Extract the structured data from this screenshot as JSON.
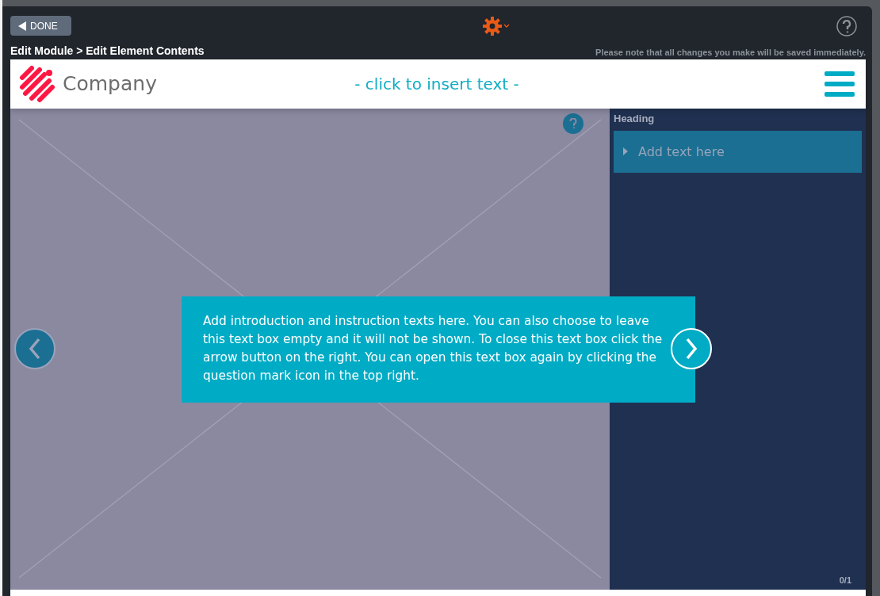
{
  "toolbar": {
    "done_button": "DONE",
    "breadcrumb": "Edit Module > Edit Element Contents",
    "note": "Please note that all changes you make will be saved immediately."
  },
  "header": {
    "logo_text": "Company",
    "title": "- click to insert text -"
  },
  "slide": {
    "intro": "Add introduction and instruction texts here. You can also choose to leave this text box empty and it will not be shown. To close this text box click the arrow button on the right. You can open this text box again by clicking the question mark icon in the top right."
  },
  "sidebar": {
    "heading": "Heading",
    "items": [
      {
        "label": "Add text here",
        "expanded": false
      }
    ],
    "counter": "0/1"
  }
}
